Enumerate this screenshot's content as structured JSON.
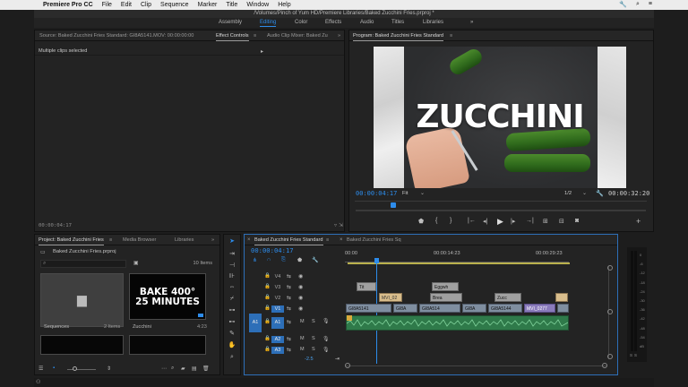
{
  "menubar": {
    "app": "Premiere Pro CC",
    "items": [
      "File",
      "Edit",
      "Clip",
      "Sequence",
      "Marker",
      "Title",
      "Window",
      "Help"
    ]
  },
  "window_title": "/Volumes/Pinch of Yum HD/Premiere Libraries/Baked Zucchini Fries.prproj *",
  "workspaces": [
    "Assembly",
    "Editing",
    "Color",
    "Effects",
    "Audio",
    "Titles",
    "Libraries"
  ],
  "workspace_overflow": "»",
  "source_panel": {
    "tabs": [
      "Source: Baked Zucchini Fries Standard: GI8A5141.MOV: 00:00:00:00",
      "Effect Controls",
      "Audio Clip Mixer: Baked Zu"
    ],
    "message": "Multiple clips selected",
    "timecode": "00:00:04:17"
  },
  "program_panel": {
    "tab": "Program: Baked Zucchini Fries Standard",
    "overlay_title": "ZUCCHINI",
    "timecode": "00:00:04:17",
    "fit": "Fit",
    "resolution": "1/2",
    "duration": "00:00:32:20"
  },
  "project_panel": {
    "tabs": [
      "Project: Baked Zucchini Fries",
      "Media Browser",
      "Libraries"
    ],
    "filename": "Baked Zucchini Fries.prproj",
    "item_count": "10 Items",
    "bins": [
      {
        "name": "Sequences",
        "meta": "2 Items"
      },
      {
        "name": "Zucchini",
        "meta": "4:23",
        "thumb_text": "BAKE 400°\n25 MINUTES"
      }
    ]
  },
  "timeline": {
    "tabs": [
      "Baked Zucchini Fries Standard",
      "Baked Zucchini Fries Sq"
    ],
    "timecode": "00:00:04:17",
    "ruler": [
      "00:00",
      "00:00:14:23",
      "00:00:29:23"
    ],
    "tracks_video": [
      "V4",
      "V3",
      "V2",
      "V1"
    ],
    "tracks_audio": [
      "A1",
      "A2",
      "A3"
    ],
    "source_patch": "A1",
    "volume": "-2.5",
    "clips": {
      "v3": [
        "Tit",
        "Eggwh"
      ],
      "v2": [
        "MVI_02",
        "Brea",
        "Zucc"
      ],
      "v1": [
        "GI8A5141",
        "GI8A",
        "GI8A514",
        "GI8A",
        "GI8A5144",
        "MVI_0277"
      ]
    }
  },
  "meter": {
    "labels": [
      "0",
      "-6",
      "-12",
      "-18",
      "-24",
      "-30",
      "-36",
      "-42",
      "-48",
      "-54",
      "dB"
    ],
    "foot": [
      "S",
      "S"
    ]
  },
  "colors": {
    "accent": "#2d8ceb",
    "panel": "#232323",
    "audio": "#2f7a4a"
  }
}
